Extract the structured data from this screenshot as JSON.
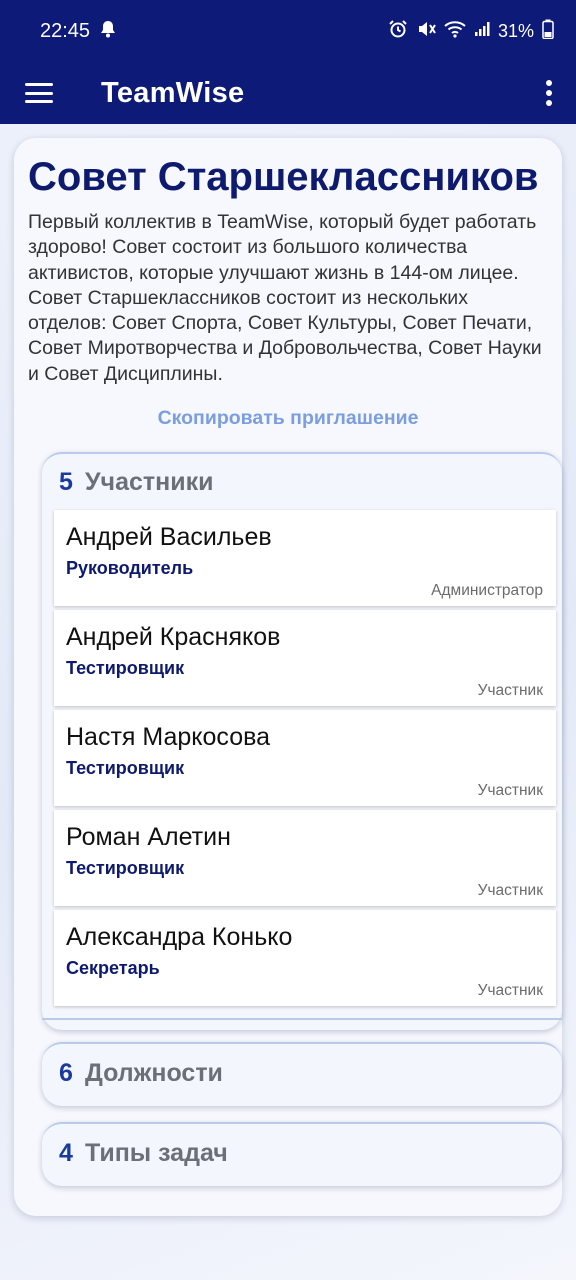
{
  "status_bar": {
    "time": "22:45",
    "battery": "31%"
  },
  "app_bar": {
    "title": "TeamWise"
  },
  "team": {
    "title": "Совет Старшеклассников",
    "description": "Первый коллектив в TeamWise, который будет работать здорово! Совет состоит из большого количества активистов, которые улучшают жизнь в 144-ом лицее. Совет Старшеклассников состоит из нескольких отделов: Совет Спорта, Совет Культуры, Совет Печати, Совет Миротворчества и Добровольчества, Совет Науки и Совет Дисциплины.",
    "copy_invite_label": "Скопировать приглашение"
  },
  "members_section": {
    "count": "5",
    "label": "Участники",
    "members": [
      {
        "name": "Андрей Васильев",
        "role": "Руководитель",
        "access": "Администратор"
      },
      {
        "name": "Андрей Красняков",
        "role": "Тестировщик",
        "access": "Участник"
      },
      {
        "name": "Настя Маркосова",
        "role": "Тестировщик",
        "access": "Участник"
      },
      {
        "name": "Роман Алетин",
        "role": "Тестировщик",
        "access": "Участник"
      },
      {
        "name": "Александра Конько",
        "role": "Секретарь",
        "access": "Участник"
      }
    ]
  },
  "positions_section": {
    "count": "6",
    "label": "Должности"
  },
  "task_types_section": {
    "count": "4",
    "label": "Типы задач"
  },
  "icons": {
    "menu": "hamburger-menu-icon",
    "more": "more-vert-icon",
    "notification": "bell-icon",
    "alarm": "alarm-icon",
    "mute": "mute-icon",
    "wifi": "wifi-icon",
    "signal": "signal-icon",
    "battery": "battery-icon"
  },
  "colors": {
    "app_bar": "#0d1a78",
    "title": "#0d1a6e",
    "accent_link": "#7b9ee0",
    "count": "#1a3aa0"
  }
}
